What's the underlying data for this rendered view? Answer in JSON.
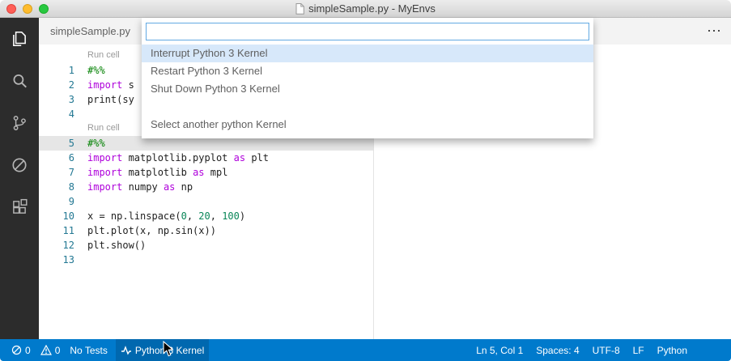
{
  "colors": {
    "statusbar_bg": "#007acc",
    "keyword": "#af00db",
    "comment": "#008000",
    "number": "#098658",
    "selection_bg": "#d7e8fa",
    "cell_highlight": "#e6e6e6"
  },
  "titlebar": {
    "title": "simpleSample.py - MyEnvs"
  },
  "tabbar": {
    "active_tab": "simpleSample.py",
    "more_actions_icon": "⋯"
  },
  "quick_pick": {
    "input": {
      "value": ""
    },
    "items": [
      {
        "label": "Interrupt Python 3 Kernel",
        "selected": true
      },
      {
        "label": "Restart Python 3 Kernel",
        "selected": false
      },
      {
        "label": "Shut Down Python 3 Kernel",
        "selected": false
      },
      {
        "label": "Select another python Kernel",
        "selected": false,
        "separator_before": true
      }
    ]
  },
  "editor": {
    "codelens_label": "Run cell",
    "rows": [
      {
        "type": "codelens"
      },
      {
        "type": "line",
        "num": "1",
        "tokens": [
          [
            "#%%",
            "comment"
          ]
        ]
      },
      {
        "type": "line",
        "num": "2",
        "tokens": [
          [
            "import",
            "kw"
          ],
          [
            " s",
            "plain"
          ]
        ]
      },
      {
        "type": "line",
        "num": "3",
        "tokens": [
          [
            "print(sy",
            "plain"
          ]
        ]
      },
      {
        "type": "line",
        "num": "4",
        "tokens": []
      },
      {
        "type": "codelens"
      },
      {
        "type": "line",
        "num": "5",
        "tokens": [
          [
            "#%%",
            "comment"
          ]
        ],
        "highlight": true
      },
      {
        "type": "line",
        "num": "6",
        "tokens": [
          [
            "import",
            "kw"
          ],
          [
            " matplotlib.pyplot ",
            "plain"
          ],
          [
            "as",
            "kw"
          ],
          [
            " plt",
            "plain"
          ]
        ]
      },
      {
        "type": "line",
        "num": "7",
        "tokens": [
          [
            "import",
            "kw"
          ],
          [
            " matplotlib ",
            "plain"
          ],
          [
            "as",
            "kw"
          ],
          [
            " mpl",
            "plain"
          ]
        ]
      },
      {
        "type": "line",
        "num": "8",
        "tokens": [
          [
            "import",
            "kw"
          ],
          [
            " numpy ",
            "plain"
          ],
          [
            "as",
            "kw"
          ],
          [
            " np",
            "plain"
          ]
        ]
      },
      {
        "type": "line",
        "num": "9",
        "tokens": []
      },
      {
        "type": "line",
        "num": "10",
        "tokens": [
          [
            "x = np.linspace(",
            "plain"
          ],
          [
            "0",
            "num"
          ],
          [
            ", ",
            "plain"
          ],
          [
            "20",
            "num"
          ],
          [
            ", ",
            "plain"
          ],
          [
            "100",
            "num"
          ],
          [
            ")",
            "plain"
          ]
        ]
      },
      {
        "type": "line",
        "num": "11",
        "tokens": [
          [
            "plt.plot(x, np.sin(x))",
            "plain"
          ]
        ]
      },
      {
        "type": "line",
        "num": "12",
        "tokens": [
          [
            "plt.show()",
            "plain"
          ]
        ]
      },
      {
        "type": "line",
        "num": "13",
        "tokens": []
      }
    ]
  },
  "activity_bar": {
    "items": [
      {
        "name": "explorer",
        "active": true
      },
      {
        "name": "search",
        "active": false
      },
      {
        "name": "source-control",
        "active": false
      },
      {
        "name": "debug",
        "active": false
      },
      {
        "name": "extensions",
        "active": false
      }
    ]
  },
  "statusbar": {
    "errors": "0",
    "warnings": "0",
    "tests": "No Tests",
    "kernel": "Python 3 Kernel",
    "right": [
      "Ln 5, Col 1",
      "Spaces: 4",
      "UTF-8",
      "LF",
      "Python"
    ]
  }
}
